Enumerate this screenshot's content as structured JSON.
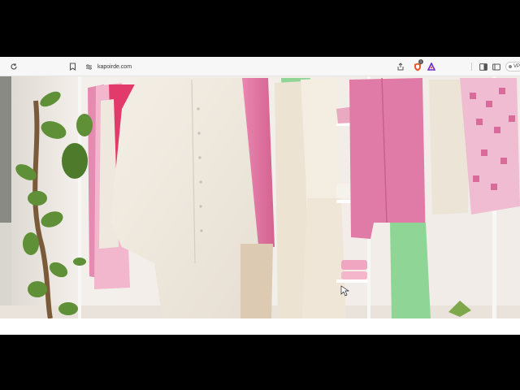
{
  "browser": {
    "url": "kapoirde.com",
    "shield_count": "1",
    "vpn_label": "VP"
  },
  "icons": {
    "reload": "reload-icon",
    "bookmark": "bookmark-icon",
    "site_info": "site-info-icon",
    "share": "share-icon",
    "shield": "brave-shield-icon",
    "rewards": "rewards-triangle-icon",
    "sidebar": "sidebar-icon",
    "wallet": "wallet-icon"
  },
  "colors": {
    "accent_pink": "#e07aa6",
    "shield_orange": "#e8582a",
    "rewards_purple": "#6b2ed1"
  }
}
